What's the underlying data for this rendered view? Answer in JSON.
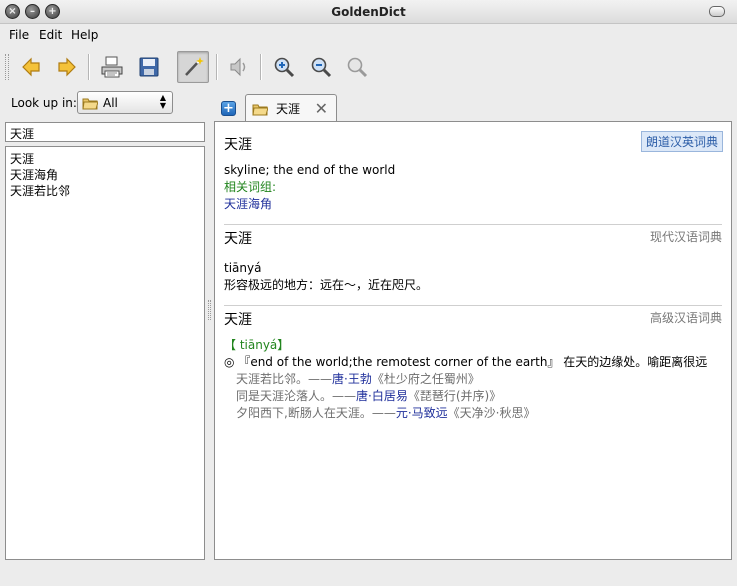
{
  "window": {
    "title": "GoldenDict"
  },
  "menu": {
    "file": "File",
    "edit": "Edit",
    "help": "Help"
  },
  "toolbar": {
    "buttons": [
      "back-icon",
      "forward-icon",
      "print-icon",
      "save-icon",
      "scan-popup-icon",
      "pronounce-icon",
      "zoom-in-icon",
      "zoom-out-icon",
      "zoom-reset-icon"
    ],
    "active": "scan-popup-icon"
  },
  "lookup": {
    "label": "Look up in:",
    "selected": "All"
  },
  "search": {
    "value": "天涯"
  },
  "wordlist": {
    "items": [
      "天涯",
      "天涯海角",
      "天涯若比邻"
    ]
  },
  "tab": {
    "label": "天涯"
  },
  "article": {
    "sec1": {
      "headword": "天涯",
      "dict": "朗道汉英词典",
      "definition": "skyline; the end of the world",
      "related_label": "相关词组:",
      "related": "天涯海角"
    },
    "sec2": {
      "headword": "天涯",
      "dict": "现代汉语词典",
      "pinyin": "tiānyá",
      "definition": "形容极远的地方：远在～，近在咫尺。"
    },
    "sec3": {
      "headword": "天涯",
      "dict": "高级汉语词典",
      "pinyin": "【 tiānyá】",
      "def_symbol": "◎",
      "def_en": "『end of the world;the remotest corner of the earth』",
      "def_zh": " 在天的边缘处。喻距离很远",
      "ex1_text": "天涯若比邻。——",
      "ex1_author": "唐·王勃",
      "ex1_work": "《杜少府之任蜀州》",
      "ex2_text": "同是天涯沦落人。——",
      "ex2_author": "唐·白居易",
      "ex2_work": "《琵琶行(并序)》",
      "ex3_text": "夕阳西下,断肠人在天涯。——",
      "ex3_author": "元·马致远",
      "ex3_work": "《天净沙·秋思》"
    }
  },
  "colors": {
    "green": "#22851e",
    "blue": "#1f2f9b",
    "accent": "#2d5ea8"
  }
}
